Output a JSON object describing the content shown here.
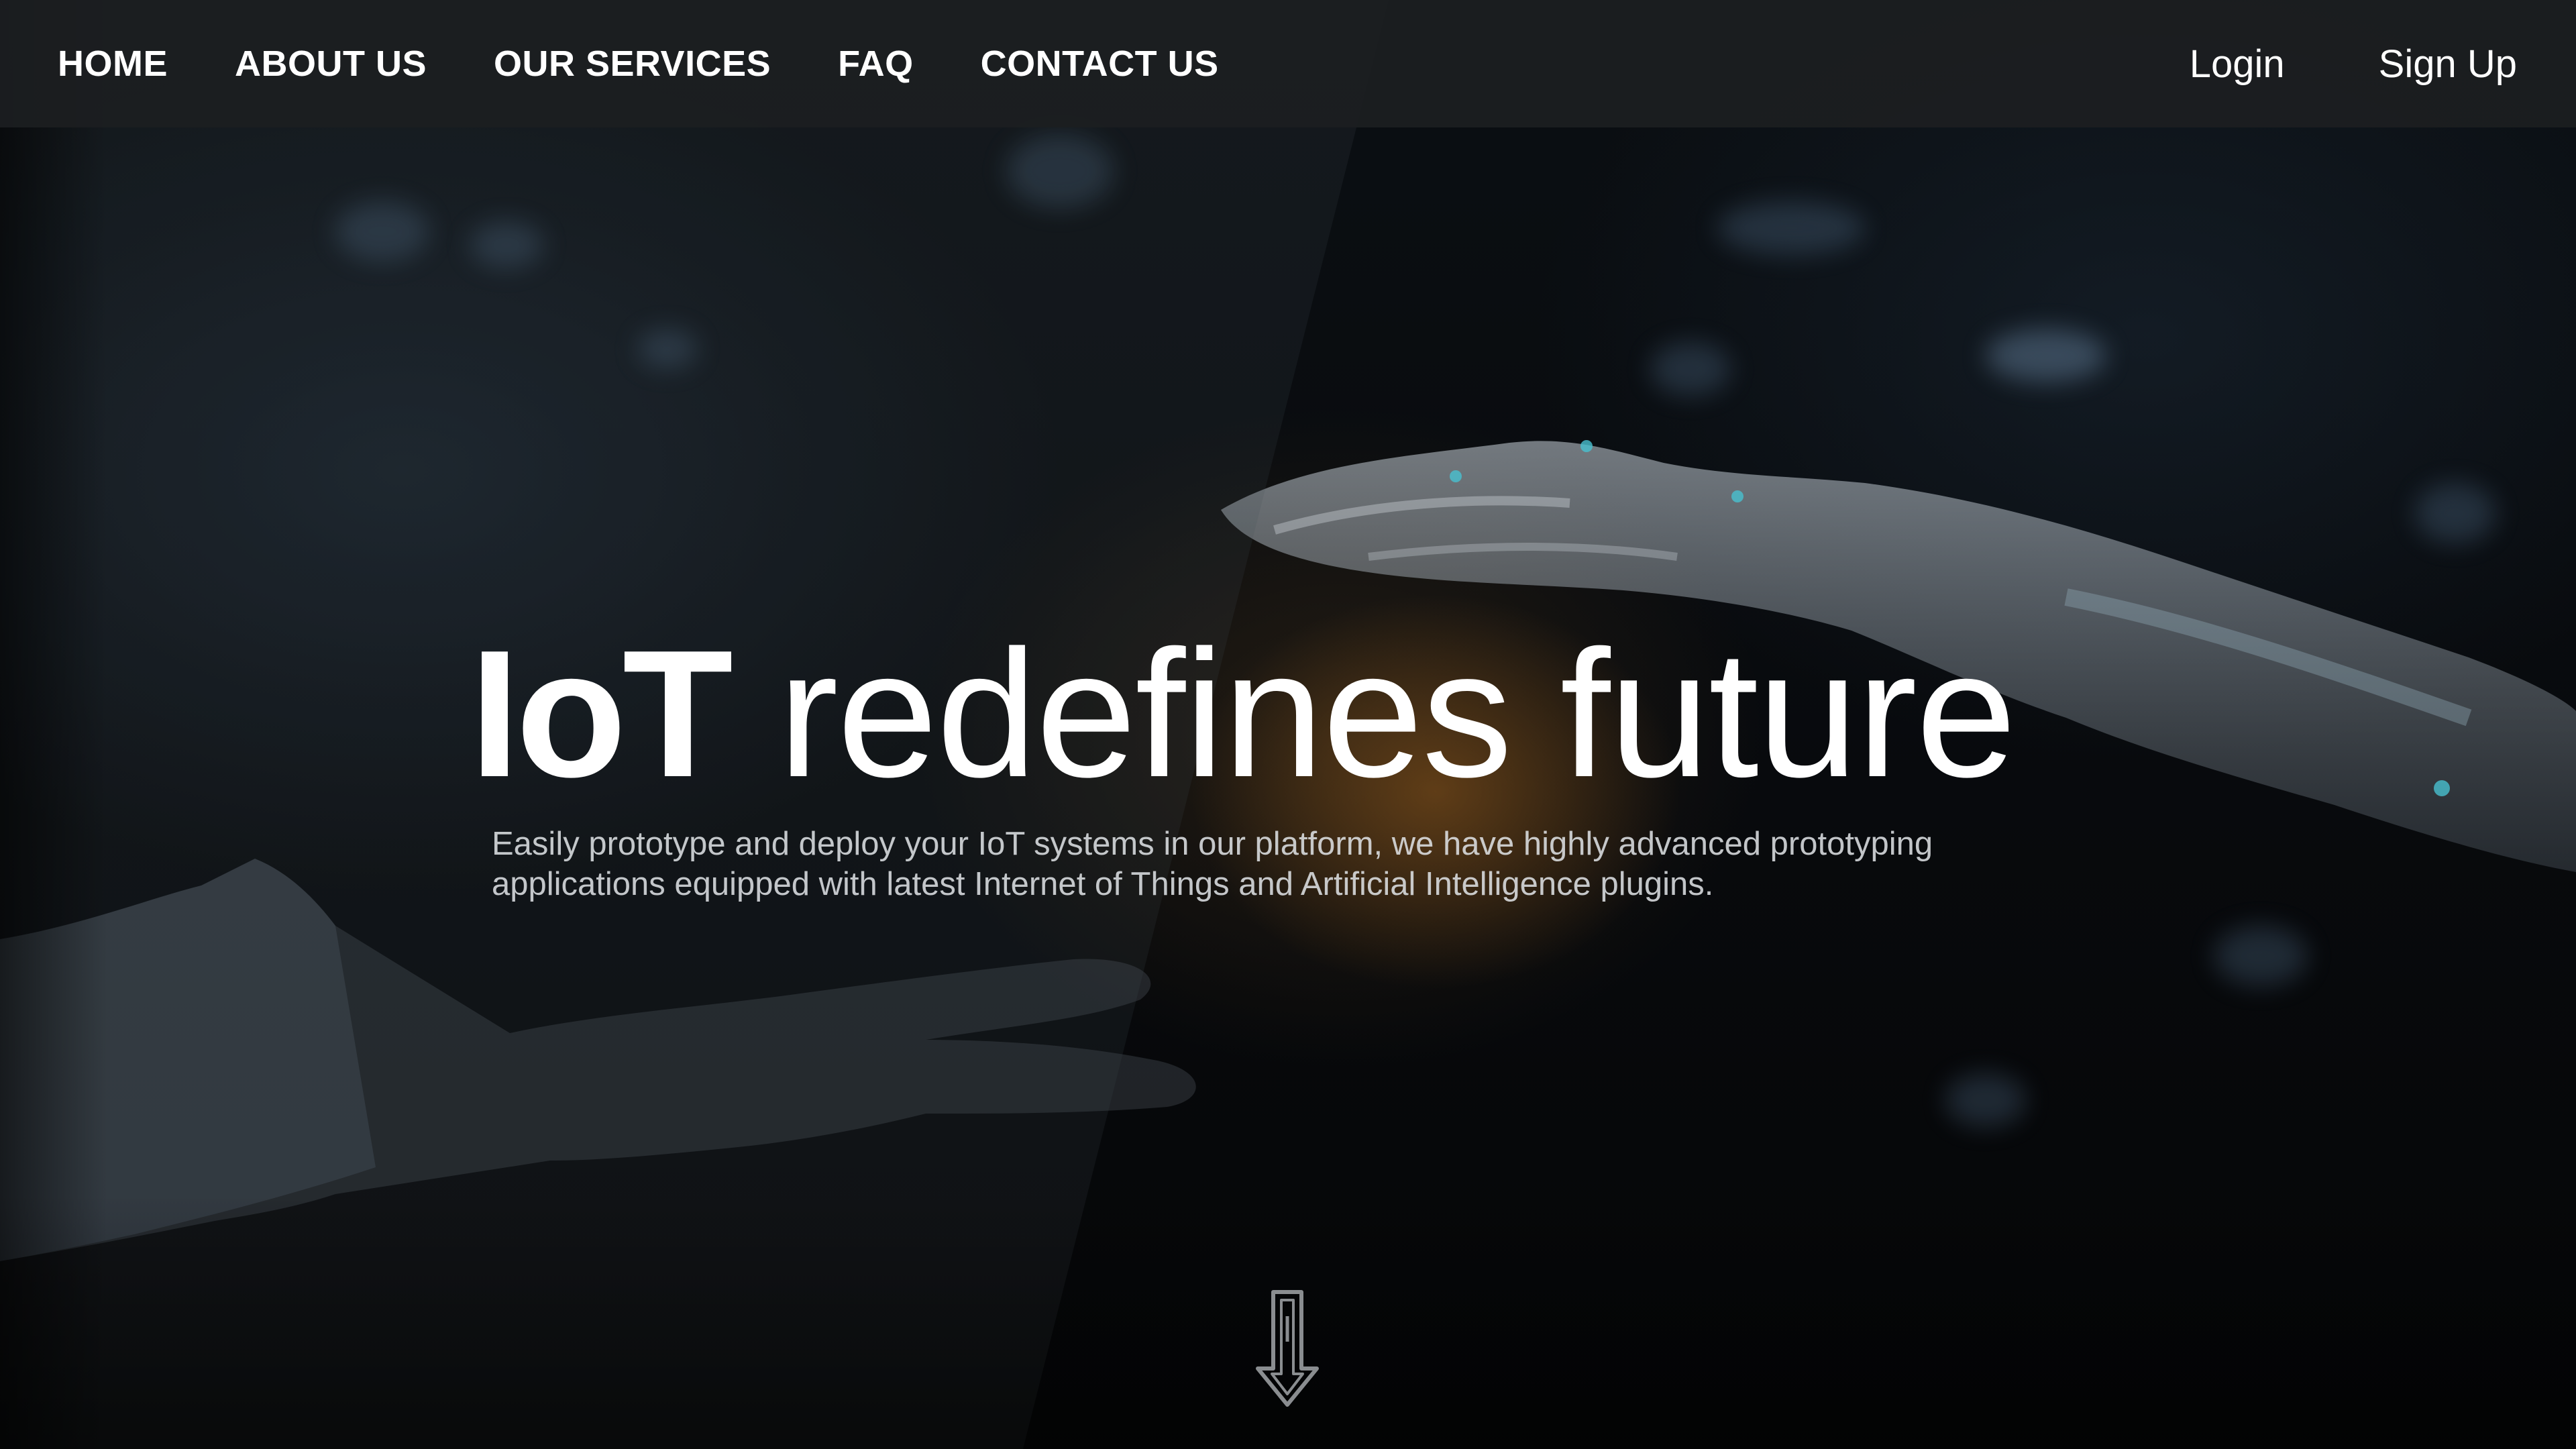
{
  "navbar": {
    "links": [
      {
        "label": "HOME"
      },
      {
        "label": "ABOUT US"
      },
      {
        "label": "OUR SERVICES"
      },
      {
        "label": "FAQ"
      },
      {
        "label": "CONTACT US"
      }
    ],
    "login_label": "Login",
    "signup_label": "Sign Up"
  },
  "hero": {
    "title_strong": "IoT",
    "title_rest": " redefines future",
    "subtitle": "Easily prototype and deploy your IoT systems in our platform, we have highly advanced prototyping applications equipped with latest Internet of Things and Artificial Intelligence plugins.",
    "scroll_icon": "down-arrow-icon"
  },
  "colors": {
    "navbar_bg": "#1c1e21",
    "text": "#ffffff",
    "glow": "#965c1c"
  }
}
